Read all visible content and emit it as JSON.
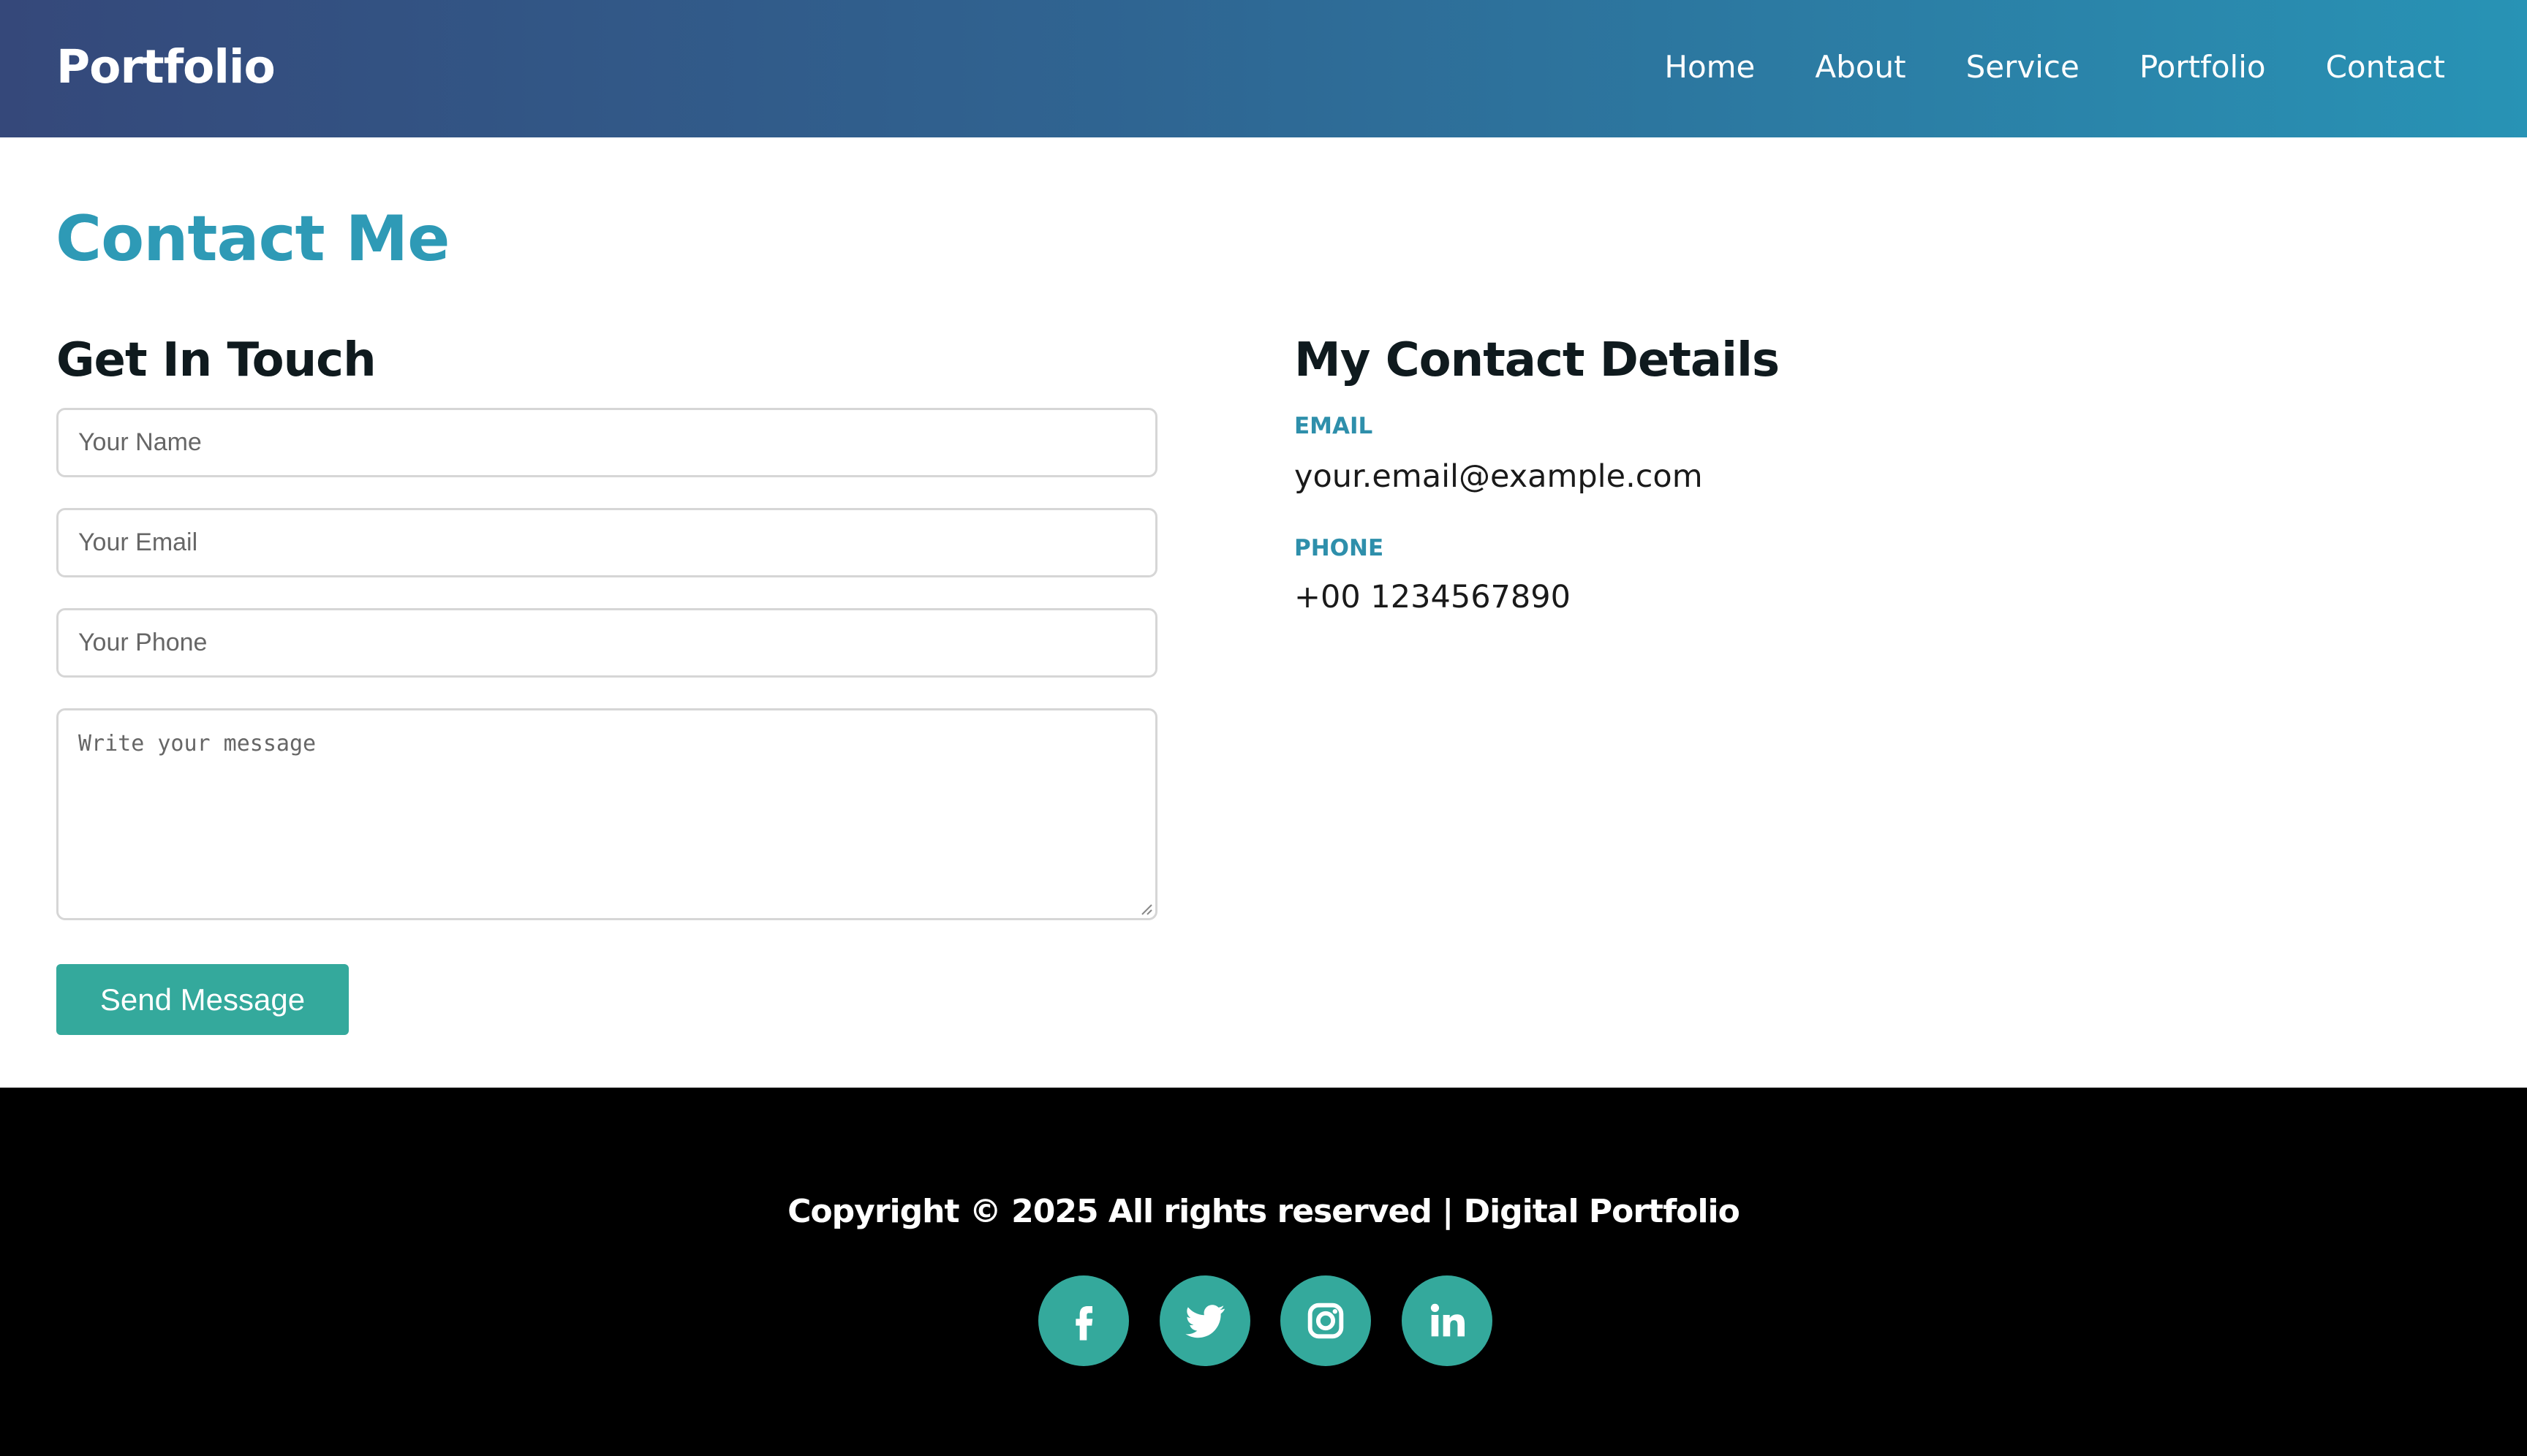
{
  "header": {
    "logo": "Portfolio",
    "nav": [
      "Home",
      "About",
      "Service",
      "Portfolio",
      "Contact"
    ]
  },
  "main": {
    "title": "Contact Me",
    "form": {
      "heading": "Get In Touch",
      "name_placeholder": "Your Name",
      "email_placeholder": "Your Email",
      "phone_placeholder": "Your Phone",
      "message_placeholder": "Write your message",
      "submit_label": "Send Message"
    },
    "details": {
      "heading": "My Contact Details",
      "email_label": "EMAIL",
      "email_value": "your.email@example.com",
      "phone_label": "PHONE",
      "phone_value": "+00 1234567890"
    }
  },
  "footer": {
    "copyright": "Copyright © 2025 All rights reserved | Digital Portfolio",
    "social": [
      "facebook-icon",
      "twitter-icon",
      "instagram-icon",
      "linkedin-icon"
    ]
  },
  "colors": {
    "accent": "#34a99c",
    "title": "#2e9ab6",
    "header_gradient_start": "#35487a",
    "header_gradient_end": "#2893b5"
  }
}
